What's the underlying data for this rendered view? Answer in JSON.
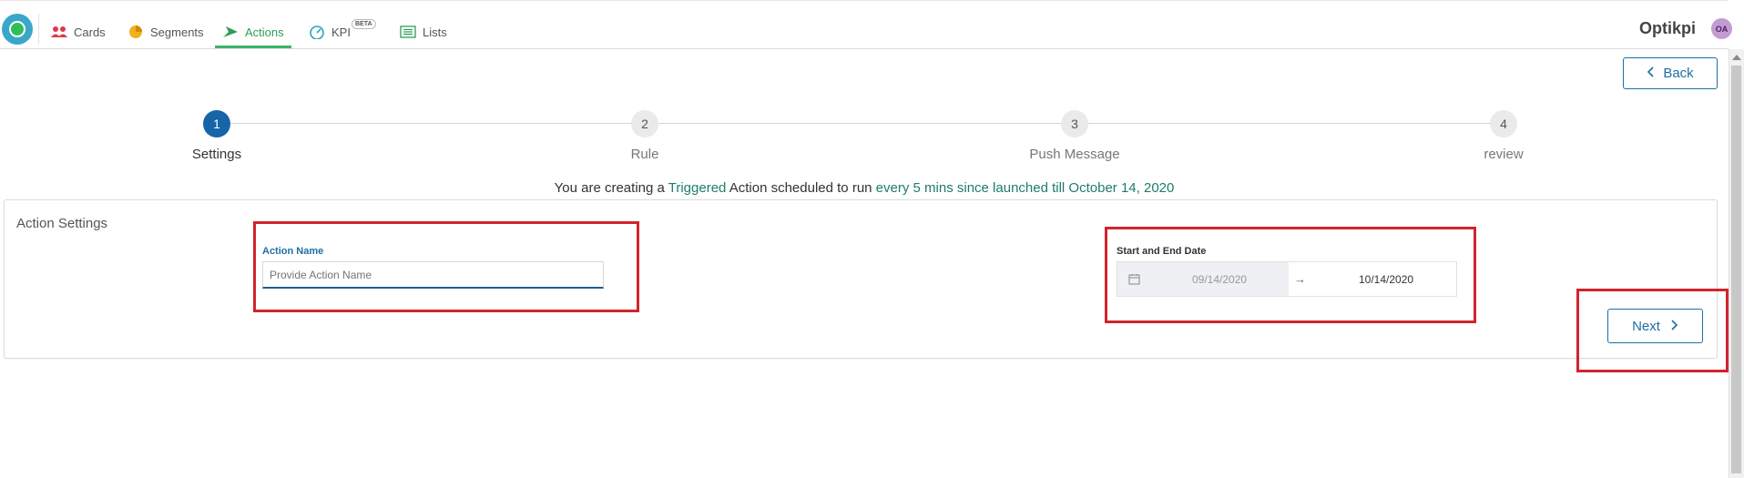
{
  "nav": {
    "items": [
      {
        "label": "Cards",
        "icon": "users-icon"
      },
      {
        "label": "Segments",
        "icon": "pie-chart-icon"
      },
      {
        "label": "Actions",
        "icon": "send-icon"
      },
      {
        "label": "KPI",
        "icon": "speedometer-icon",
        "badge": "BETA"
      },
      {
        "label": "Lists",
        "icon": "list-icon"
      }
    ],
    "active": "Actions"
  },
  "brand": "Optikpi",
  "user": {
    "initials": "OA"
  },
  "back_label": "Back",
  "steps": [
    {
      "number": "1",
      "label": "Settings",
      "current": true
    },
    {
      "number": "2",
      "label": "Rule",
      "current": false
    },
    {
      "number": "3",
      "label": "Push Message",
      "current": false
    },
    {
      "number": "4",
      "label": "review",
      "current": false
    }
  ],
  "summary": {
    "part1": "You are creating a ",
    "type": "Triggered",
    "part2": " Action scheduled to run ",
    "schedule": "every 5 mins since launched till October 14, 2020"
  },
  "card": {
    "title": "Action Settings",
    "action_name": {
      "label": "Action Name",
      "placeholder": "Provide Action Name"
    },
    "date_range": {
      "label": "Start and End Date",
      "start": "09/14/2020",
      "separator": "→",
      "end": "10/14/2020"
    }
  },
  "next_label": "Next",
  "colors": {
    "accent": "#1f6fa3",
    "active_nav": "#2e9e57",
    "highlight": "#d0242e",
    "step_current": "#1565a8"
  }
}
